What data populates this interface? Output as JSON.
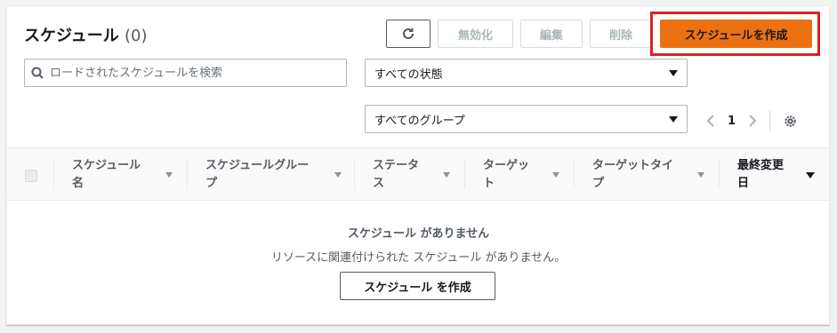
{
  "header": {
    "title": "スケジュール",
    "count": "(0)"
  },
  "toolbar": {
    "refresh_icon": "refresh-icon",
    "disable_label": "無効化",
    "edit_label": "編集",
    "delete_label": "削除",
    "create_label": "スケジュールを作成"
  },
  "search": {
    "placeholder": "ロードされたスケジュールを検索",
    "value": ""
  },
  "filters": {
    "status": "すべての状態",
    "group": "すべてのグループ"
  },
  "pagination": {
    "page": "1"
  },
  "table": {
    "columns": [
      {
        "line1": "スケジュール",
        "line2": "名"
      },
      {
        "line1": "スケジュールグルー",
        "line2": "プ"
      },
      {
        "line1": "ステータ",
        "line2": "ス"
      },
      {
        "line1": "ターゲッ",
        "line2": "ト"
      },
      {
        "line1": "ターゲットタイ",
        "line2": "プ"
      },
      {
        "line1": "最終変更",
        "line2": "日"
      }
    ]
  },
  "empty": {
    "title": "スケジュール がありません",
    "subtitle": "リソースに関連付けられた スケジュール がありません。",
    "create_label": "スケジュール を作成"
  },
  "colors": {
    "primary": "#ec7211",
    "highlight": "#e0201f"
  }
}
